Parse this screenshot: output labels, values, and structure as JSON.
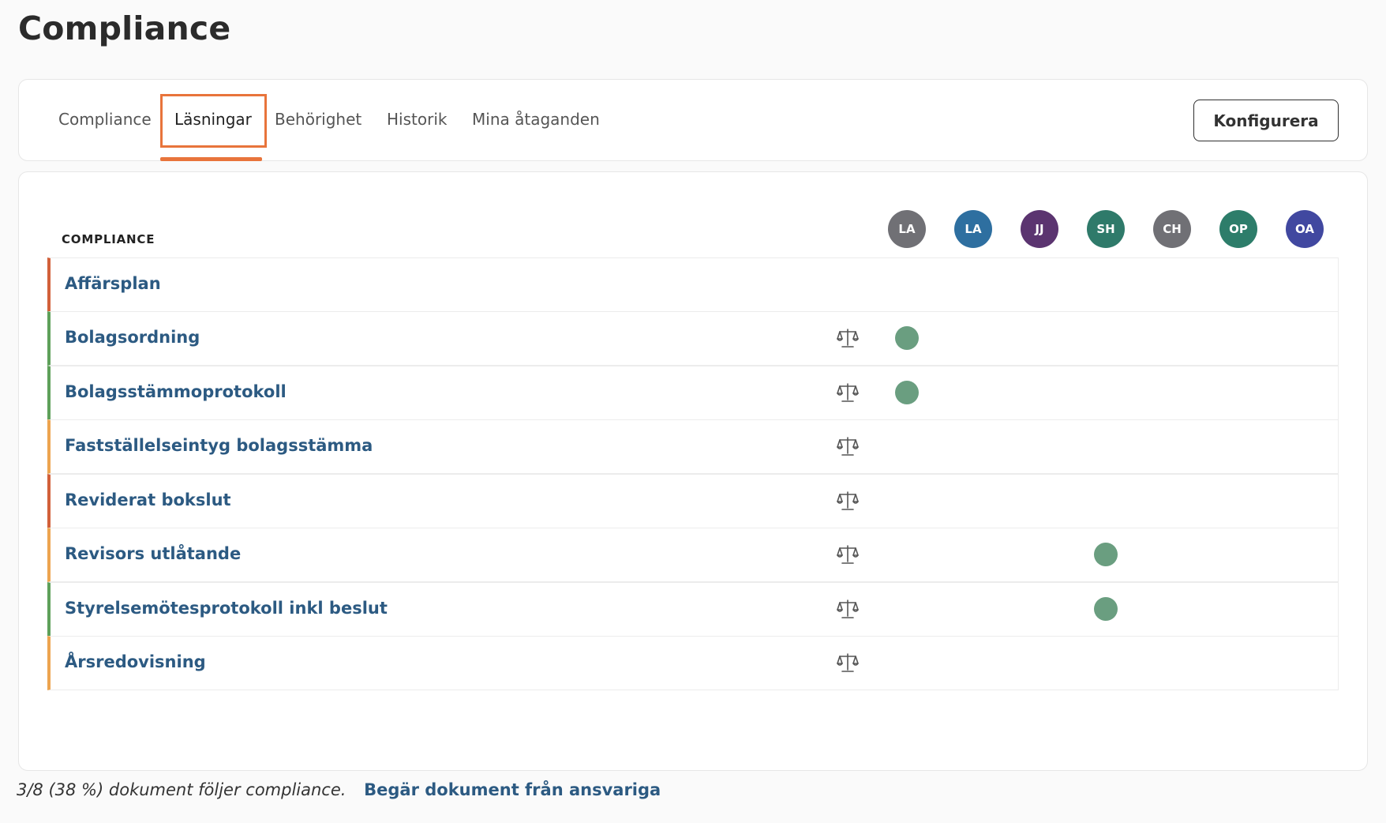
{
  "page": {
    "title": "Compliance"
  },
  "tabs": [
    {
      "label": "Compliance",
      "active": false
    },
    {
      "label": "Läsningar",
      "active": true
    },
    {
      "label": "Behörighet",
      "active": false
    },
    {
      "label": "Historik",
      "active": false
    },
    {
      "label": "Mina åtaganden",
      "active": false
    }
  ],
  "toolbar": {
    "configure_label": "Konfigurera"
  },
  "table": {
    "header": "COMPLIANCE",
    "people": [
      {
        "initials": "LA",
        "color": "#707075"
      },
      {
        "initials": "LA",
        "color": "#2e6fa0"
      },
      {
        "initials": "JJ",
        "color": "#5b3470"
      },
      {
        "initials": "SH",
        "color": "#2f7a6a"
      },
      {
        "initials": "CH",
        "color": "#707075"
      },
      {
        "initials": "OP",
        "color": "#2d7d6a"
      },
      {
        "initials": "OA",
        "color": "#4148a0"
      }
    ],
    "rows": [
      {
        "name": "Affärsplan",
        "status_color": "#d2603a",
        "has_scale_icon": false,
        "read_by": []
      },
      {
        "name": "Bolagsordning",
        "status_color": "#5ea05a",
        "has_scale_icon": true,
        "read_by": [
          0
        ]
      },
      {
        "name": "Bolagsstämmoprotokoll",
        "status_color": "#5ea05a",
        "has_scale_icon": true,
        "read_by": [
          0
        ]
      },
      {
        "name": "Fastställelseintyg bolagsstämma",
        "status_color": "#eda44f",
        "has_scale_icon": true,
        "read_by": []
      },
      {
        "name": "Reviderat bokslut",
        "status_color": "#d2603a",
        "has_scale_icon": true,
        "read_by": []
      },
      {
        "name": "Revisors utlåtande",
        "status_color": "#eda44f",
        "has_scale_icon": true,
        "read_by": [
          3
        ]
      },
      {
        "name": "Styrelsemötesprotokoll inkl beslut",
        "status_color": "#5ea05a",
        "has_scale_icon": true,
        "read_by": [
          3
        ]
      },
      {
        "name": "Årsredovisning",
        "status_color": "#eda44f",
        "has_scale_icon": true,
        "read_by": []
      }
    ],
    "read_dot_color": "#6a9e80"
  },
  "footer": {
    "summary": "3/8 (38 %) dokument följer compliance.",
    "request_link": "Begär dokument från ansvariga"
  }
}
